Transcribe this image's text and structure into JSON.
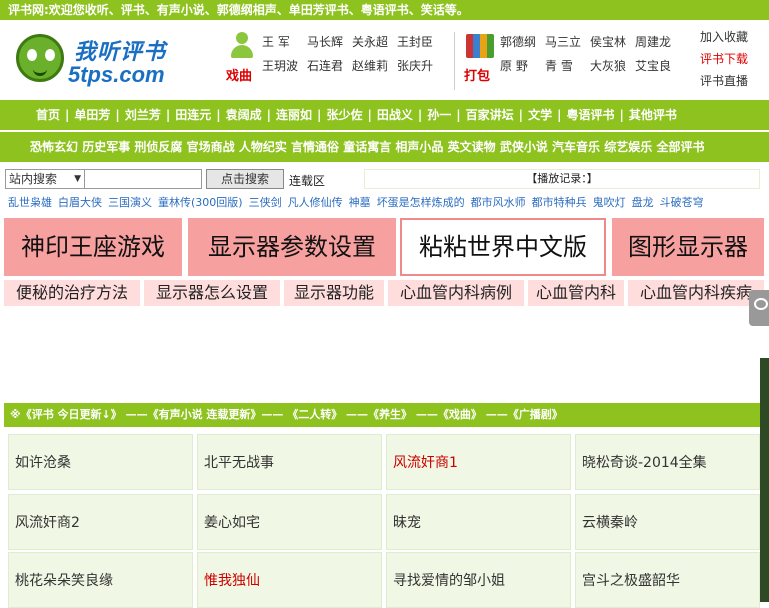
{
  "topbar": {
    "text": "评书网:欢迎您收听、评书、有声小说、郭德纲相声、单田芳评书、粤语评书、笑话等。"
  },
  "logo": {
    "line1": "我听评书",
    "line2": "5tps.com"
  },
  "header": {
    "group1": {
      "tag": "戏曲",
      "names": [
        "王 军",
        "马长辉",
        "关永超",
        "王封臣",
        "王玥波",
        "石连君",
        "赵维莉",
        "张庆升"
      ]
    },
    "group2": {
      "tag": "打包",
      "names": [
        "郭德纲",
        "马三立",
        "侯宝林",
        "周建龙",
        "原 野",
        "青 雪",
        "大灰狼",
        "艾宝良"
      ]
    },
    "right_links": [
      "加入收藏",
      "评书下载",
      "评书直播"
    ]
  },
  "nav1": [
    "首页",
    "单田芳",
    "刘兰芳",
    "田连元",
    "袁阔成",
    "连丽如",
    "张少佐",
    "田战义",
    "孙一",
    "百家讲坛",
    "文学",
    "粤语评书",
    "其他评书"
  ],
  "nav2": [
    "恐怖玄幻",
    "历史军事",
    "刑侦反腐",
    "官场商战",
    "人物纪实",
    "言情通俗",
    "童话寓言",
    "相声小品",
    "英文读物",
    "武侠小说",
    "汽车音乐",
    "综艺娱乐",
    "全部评书"
  ],
  "search": {
    "scope": "站内搜索",
    "button": "点击搜索",
    "serial": "连载区",
    "play_record": "【播放记录：】"
  },
  "links": [
    "乱世枭雄",
    "白眉大侠",
    "三国演义",
    "童林传(300回版)",
    "三侠剑",
    "凡人修仙传",
    "神墓",
    "坏蛋是怎样炼成的",
    "都市风水师",
    "都市特种兵",
    "鬼吹灯",
    "盘龙",
    "斗破苍穹"
  ],
  "ads_large": [
    "神印王座游戏",
    "显示器参数设置",
    "粘粘世界中文版",
    "图形显示器"
  ],
  "ads_small": [
    "便秘的治疗方法",
    "显示器怎么设置",
    "显示器功能",
    "心血管内科病例",
    "心血管内科",
    "心血管内科疾病"
  ],
  "update_bar": "※《评书 今日更新↓》 ——《有声小说 连载更新》—— 《二人转》 ——《养生》 ——《戏曲》 ——《广播剧》",
  "grid": [
    {
      "title": "如许沧桑",
      "highlight": false
    },
    {
      "title": "北平无战事",
      "highlight": false
    },
    {
      "title": "风流奸商1",
      "highlight": true
    },
    {
      "title": "晓松奇谈-2014全集",
      "highlight": false
    },
    {
      "title": "风流奸商2",
      "highlight": false
    },
    {
      "title": "姜心如宅",
      "highlight": false
    },
    {
      "title": "昧宠",
      "highlight": false
    },
    {
      "title": "云横秦岭",
      "highlight": false
    },
    {
      "title": "桃花朵朵笑良缘",
      "highlight": false
    },
    {
      "title": "惟我独仙",
      "highlight": true
    },
    {
      "title": "寻找爱情的邹小姐",
      "highlight": false
    },
    {
      "title": "宫斗之极盛韶华",
      "highlight": false
    }
  ]
}
